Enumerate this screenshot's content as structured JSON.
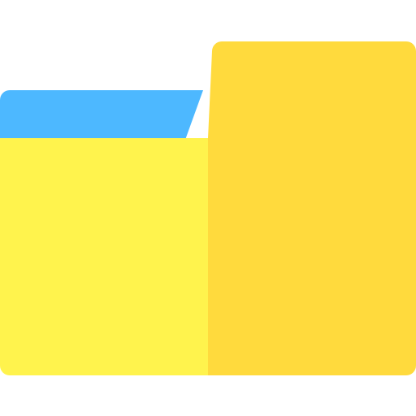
{
  "icon": {
    "name": "folder-icon",
    "colors": {
      "tab": "#4DB8FF",
      "body_left": "#FFF34D",
      "body_right": "#FFDA3D"
    }
  }
}
